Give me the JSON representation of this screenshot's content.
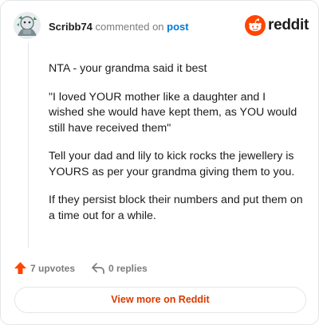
{
  "comment": {
    "username": "Scribb74",
    "action_text": "commented on",
    "post_link_text": "post",
    "paragraphs": [
      "NTA - your grandma said it best",
      "\"I loved YOUR mother like a daughter and I wished she would have kept them, as YOU would still have received them\"",
      "Tell your dad and lily to kick rocks the jewellery is YOURS as per your grandma giving them to you.",
      "If they persist block their numbers and put them on a time out for a while."
    ]
  },
  "brand": {
    "name": "reddit",
    "color": "#ff4500"
  },
  "footer": {
    "upvotes_label": "7 upvotes",
    "replies_label": "0 replies",
    "view_more_label": "View more on Reddit"
  },
  "icons": {
    "upvote": "upvote-arrow-icon",
    "reply": "reply-arrow-icon",
    "logo": "reddit-snoo-icon",
    "avatar": "user-avatar"
  }
}
